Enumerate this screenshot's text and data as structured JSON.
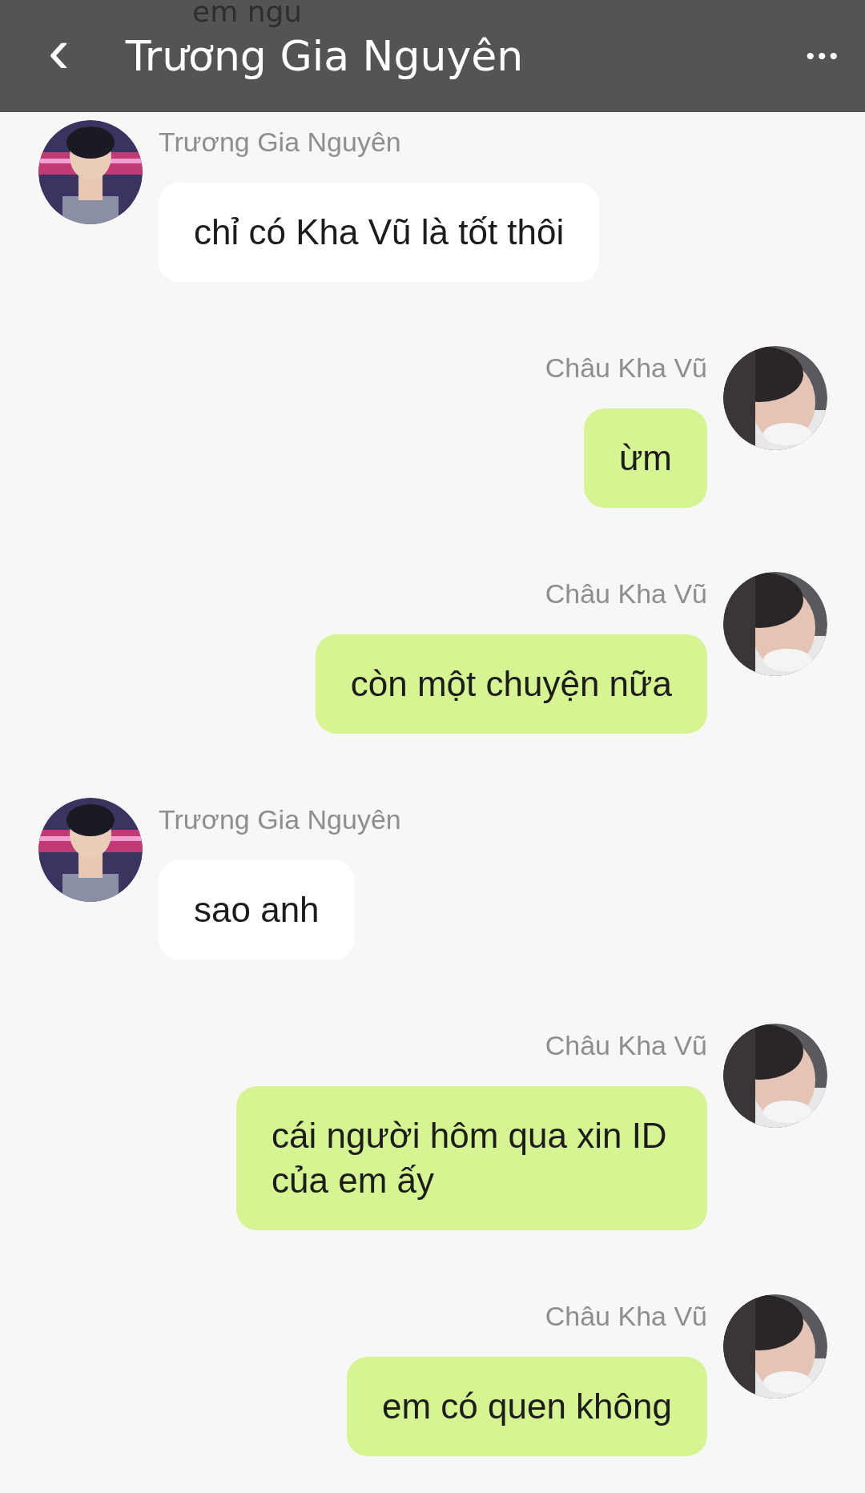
{
  "peek_text": "em ngu",
  "header": {
    "back": "‹",
    "title": "Trương Gia Nguyên",
    "menu": "•••"
  },
  "messages": [
    {
      "kind": "incoming",
      "sender": "Trương Gia Nguyên",
      "text": "chỉ có Kha Vũ là tốt thôi"
    },
    {
      "kind": "outgoing",
      "sender": "Châu Kha Vũ",
      "text": "ừm"
    },
    {
      "kind": "outgoing",
      "sender": "Châu Kha Vũ",
      "text": "còn một chuyện nữa"
    },
    {
      "kind": "incoming",
      "sender": "Trương Gia Nguyên",
      "text": "sao anh"
    },
    {
      "kind": "outgoing",
      "sender": "Châu Kha Vũ",
      "text": "cái người hôm qua xin ID của em ấy"
    },
    {
      "kind": "outgoing",
      "sender": "Châu Kha Vũ",
      "text": "em có quen không"
    }
  ]
}
